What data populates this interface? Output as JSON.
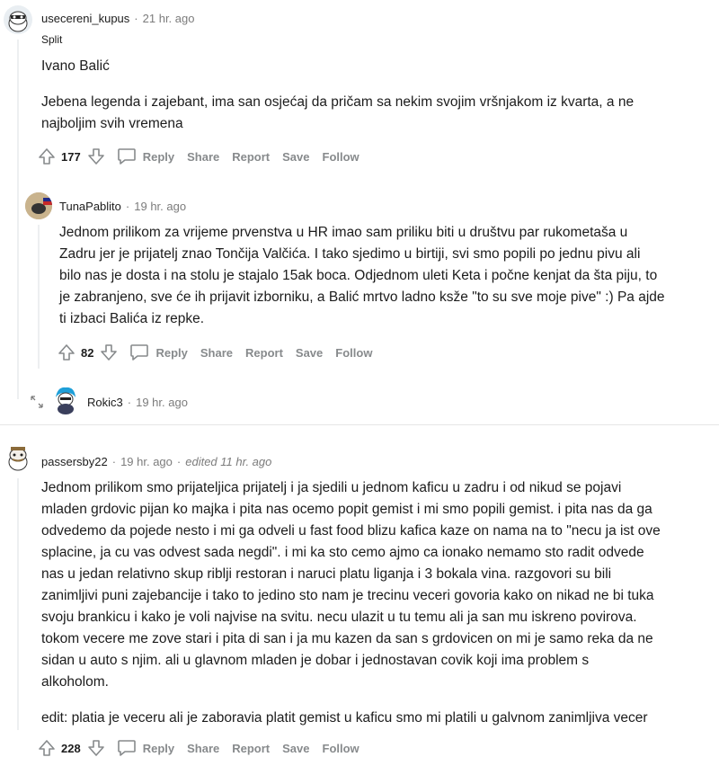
{
  "comments": [
    {
      "user": "usecereni_kupus",
      "time": "21 hr. ago",
      "flair": "Split",
      "paragraphs": [
        "Ivano Balić",
        "Jebena legenda i zajebant, ima san osjećaj da pričam sa nekim svojim vršnjakom iz kvarta, a ne\nnajboljim svih vremena"
      ],
      "score": "177"
    },
    {
      "user": "TunaPablito",
      "time": "19 hr. ago",
      "paragraphs": [
        "Jednom prilikom za vrijeme prvenstva u HR imao sam priliku biti u društvu par rukometaša u\nZadru jer je prijatelj znao Tončija Valčića. I tako sjedimo u birtiji, svi smo popili po jednu pivu ali\nbilo nas je dosta i na stolu je stajalo 15ak boca. Odjednom uleti Keta i počne kenjat da šta piju, to\nje zabranjeno, sve će ih prijavit izborniku, a Balić mrtvo ladno ksže \"to su sve moje pive\" :) Pa ajde\nti izbaci Balića iz repke."
      ],
      "score": "82"
    },
    {
      "user": "Rokic3",
      "time": "19 hr. ago"
    },
    {
      "user": "passersby22",
      "time": "19 hr. ago",
      "edited": "edited 11 hr. ago",
      "paragraphs": [
        "Jednom prilikom smo prijateljica prijatelj i ja sjedili u jednom kaficu u zadru i od nikud se pojavi\nmladen grdovic pijan ko majka i pita nas ocemo popit gemist i mi smo popili gemist. i pita nas da ga\nodvedemo da pojede nesto i mi ga odveli u fast food blizu kafica kaze on nama na to \"necu ja ist ove\nsplacine, ja cu vas odvest sada negdi\". i mi ka sto cemo ajmo ca ionako nemamo sto radit odvede\nnas u jedan relativno skup riblji restoran i naruci platu liganja i 3 bokala vina. razgovori su bili\nzanimljivi puni zajebancije i tako to jedino sto nam je trecinu veceri govoria kako on nikad ne bi tuka\nsvoju brankicu i kako je voli najvise na svitu. necu ulazit u tu temu ali ja san mu iskreno povirova.\ntokom vecere me zove stari i pita di san i ja mu kazen da san s grdovicen on mi je samo reka da ne\nsidan u auto s njim. ali u glavnom mladen je dobar i jednostavan covik koji ima problem s\nalkoholom.",
        "edit: platia je veceru ali je zaboravia platit gemist u kaficu smo mi platili u galvnom zanimljiva vecer"
      ],
      "score": "228"
    }
  ],
  "actions": {
    "reply": "Reply",
    "share": "Share",
    "report": "Report",
    "save": "Save",
    "follow": "Follow"
  },
  "icons": {
    "upvote": "upvote-arrow-icon",
    "downvote": "downvote-arrow-icon",
    "reply": "speech-bubble-icon",
    "expand": "expand-arrows-icon"
  },
  "colors": {
    "text": "#1c1c1c",
    "meta": "#7c7c7c",
    "action": "#878a8c",
    "thread_line": "#edeff1"
  }
}
